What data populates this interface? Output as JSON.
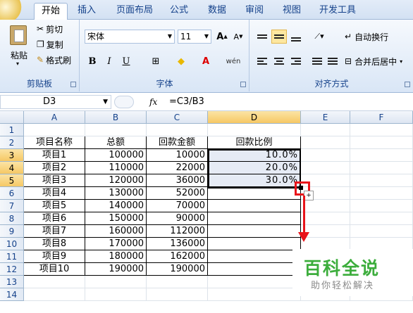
{
  "tabs": [
    "开始",
    "插入",
    "页面布局",
    "公式",
    "数据",
    "审阅",
    "视图",
    "开发工具"
  ],
  "clipboard": {
    "paste": "粘贴",
    "cut": "剪切",
    "copy": "复制",
    "format_painter": "格式刷",
    "label": "剪贴板"
  },
  "font": {
    "name": "宋体",
    "size": "11",
    "grow": "A",
    "shrink": "A",
    "bold": "B",
    "italic": "I",
    "underline": "U",
    "border": "⊞",
    "fill_color": "◆",
    "font_color": "A",
    "phonetic": "wén",
    "label": "字体"
  },
  "align": {
    "wrap": "自动换行",
    "merge": "合并后居中",
    "label": "对齐方式"
  },
  "formula_bar": {
    "name_box": "D3",
    "fx": "fx",
    "formula": "=C3/B3"
  },
  "columns": [
    "A",
    "B",
    "C",
    "D",
    "E",
    "F"
  ],
  "rows": [
    "1",
    "2",
    "3",
    "4",
    "5",
    "6",
    "7",
    "8",
    "9",
    "10",
    "11",
    "12",
    "13",
    "14"
  ],
  "table": {
    "headers": [
      "项目名称",
      "总额",
      "回款金额",
      "回款比例"
    ],
    "rows": [
      [
        "项目1",
        "100000",
        "10000",
        "10.0%"
      ],
      [
        "项目2",
        "110000",
        "22000",
        "20.0%"
      ],
      [
        "项目3",
        "120000",
        "36000",
        "30.0%"
      ],
      [
        "项目4",
        "130000",
        "52000",
        ""
      ],
      [
        "项目5",
        "140000",
        "70000",
        ""
      ],
      [
        "项目6",
        "150000",
        "90000",
        ""
      ],
      [
        "项目7",
        "160000",
        "112000",
        ""
      ],
      [
        "项目8",
        "170000",
        "136000",
        ""
      ],
      [
        "项目9",
        "180000",
        "162000",
        ""
      ],
      [
        "项目10",
        "190000",
        "190000",
        ""
      ]
    ]
  },
  "watermark": {
    "title": "百科全说",
    "subtitle": "助你轻松解决"
  },
  "colors": {
    "annotation": "#e8141a",
    "watermark": "#3cad3c"
  }
}
